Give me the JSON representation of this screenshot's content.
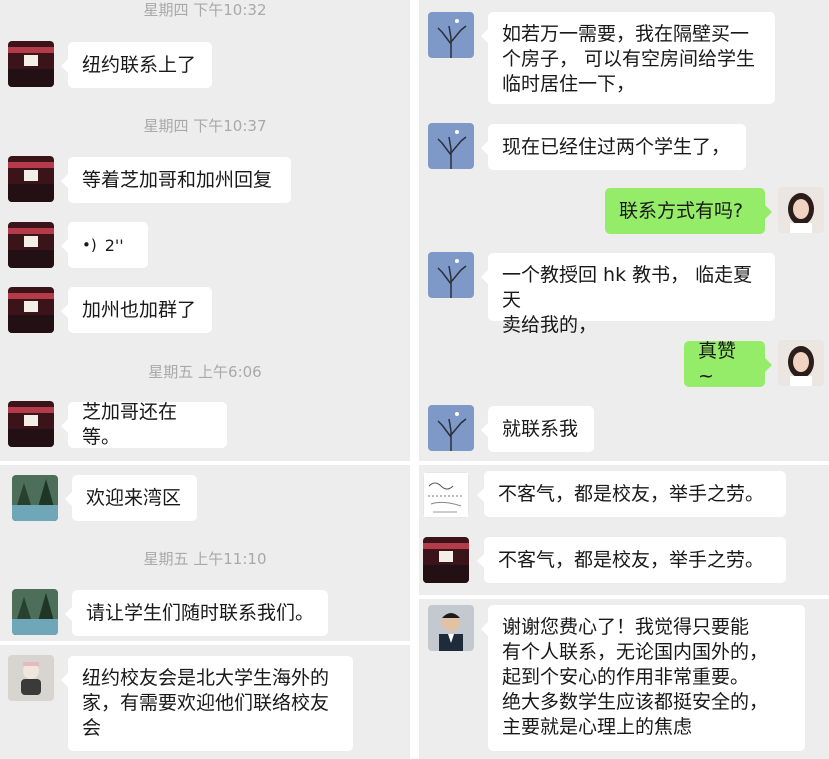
{
  "panel_a": {
    "timestamps": [
      "星期四 下午10:32",
      "星期四 下午10:37",
      "星期五 上午6:06"
    ],
    "messages": [
      "纽约联系上了",
      "等着芝加哥和加州回复",
      "2''",
      "加州也加群了",
      "芝加哥还在等。"
    ]
  },
  "panel_b": {
    "timestamps": [
      "星期五 上午11:10"
    ],
    "messages": [
      "欢迎来湾区",
      "请让学生们随时联系我们。"
    ]
  },
  "panel_c": {
    "messages": [
      "纽约校友会是北大学生海外的\n家，有需要欢迎他们联络校友\n会"
    ]
  },
  "panel_d": {
    "messages": [
      "如若万一需要，我在隔壁买一\n个房子， 可以有空房间给学生\n临时居住一下，",
      "现在已经住过两个学生了，",
      "联系方式有吗?",
      "一个教授回 hk 教书， 临走夏天\n卖给我的，",
      "真赞~",
      "就联系我"
    ]
  },
  "panel_e": {
    "messages": [
      "不客气，都是校友，举手之劳。",
      "不客气，都是校友，举手之劳。"
    ]
  },
  "panel_f": {
    "messages": [
      "谢谢您费心了！我觉得只要能\n有个人联系，无论国内国外的，\n起到个安心的作用非常重要。\n绝大多数学生应该都挺安全的，\n主要就是心理上的焦虑"
    ]
  },
  "colors": {
    "chat_background": "#ededed",
    "incoming_bubble": "#ffffff",
    "outgoing_bubble": "#95ec69",
    "timestamp_text": "#a9a9a9"
  },
  "icons": {
    "voice": "voice-wave-icon"
  }
}
